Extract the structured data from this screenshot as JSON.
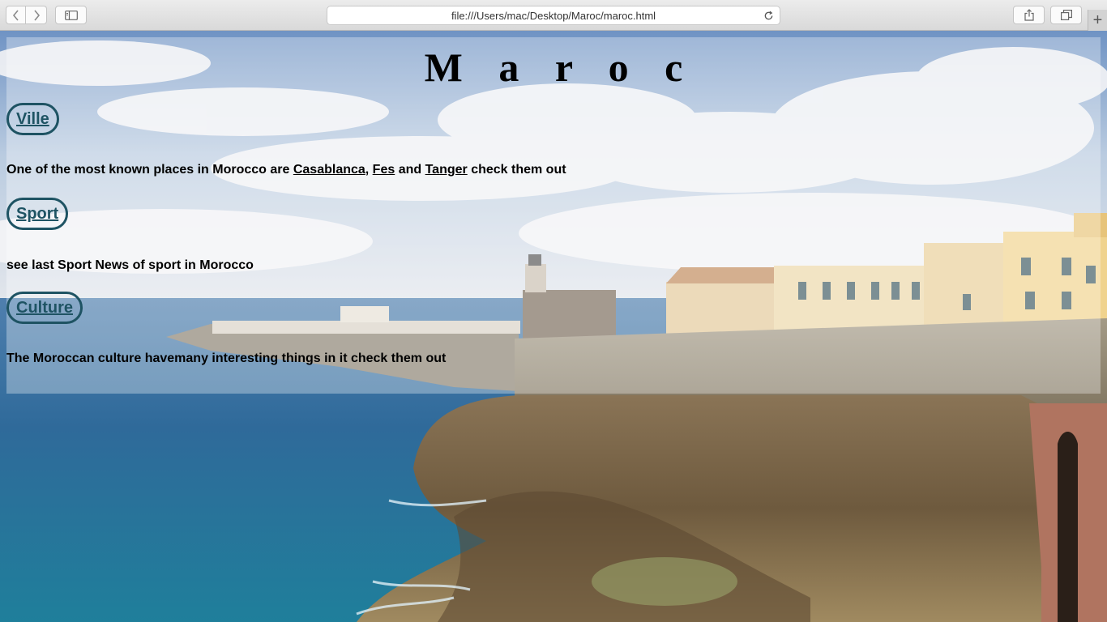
{
  "browser": {
    "url": "file:///Users/mac/Desktop/Maroc/maroc.html",
    "new_tab_label": "+"
  },
  "page": {
    "title": "M a r o c",
    "sections": [
      {
        "heading": "Ville",
        "text_before": "One of the most known places in Morocco are ",
        "links": [
          "Casablanca",
          "Fes",
          "Tanger"
        ],
        "sep1": ", ",
        "sep2": " and ",
        "text_after": " check them out"
      },
      {
        "heading": "Sport",
        "text": "see last Sport News of sport in Morocco"
      },
      {
        "heading": "Culture",
        "text": "The Moroccan culture havemany interesting things in it check them out"
      }
    ]
  },
  "colors": {
    "heading_accent": "#1e5363",
    "panel_overlay": "rgba(255,255,255,0.32)"
  }
}
